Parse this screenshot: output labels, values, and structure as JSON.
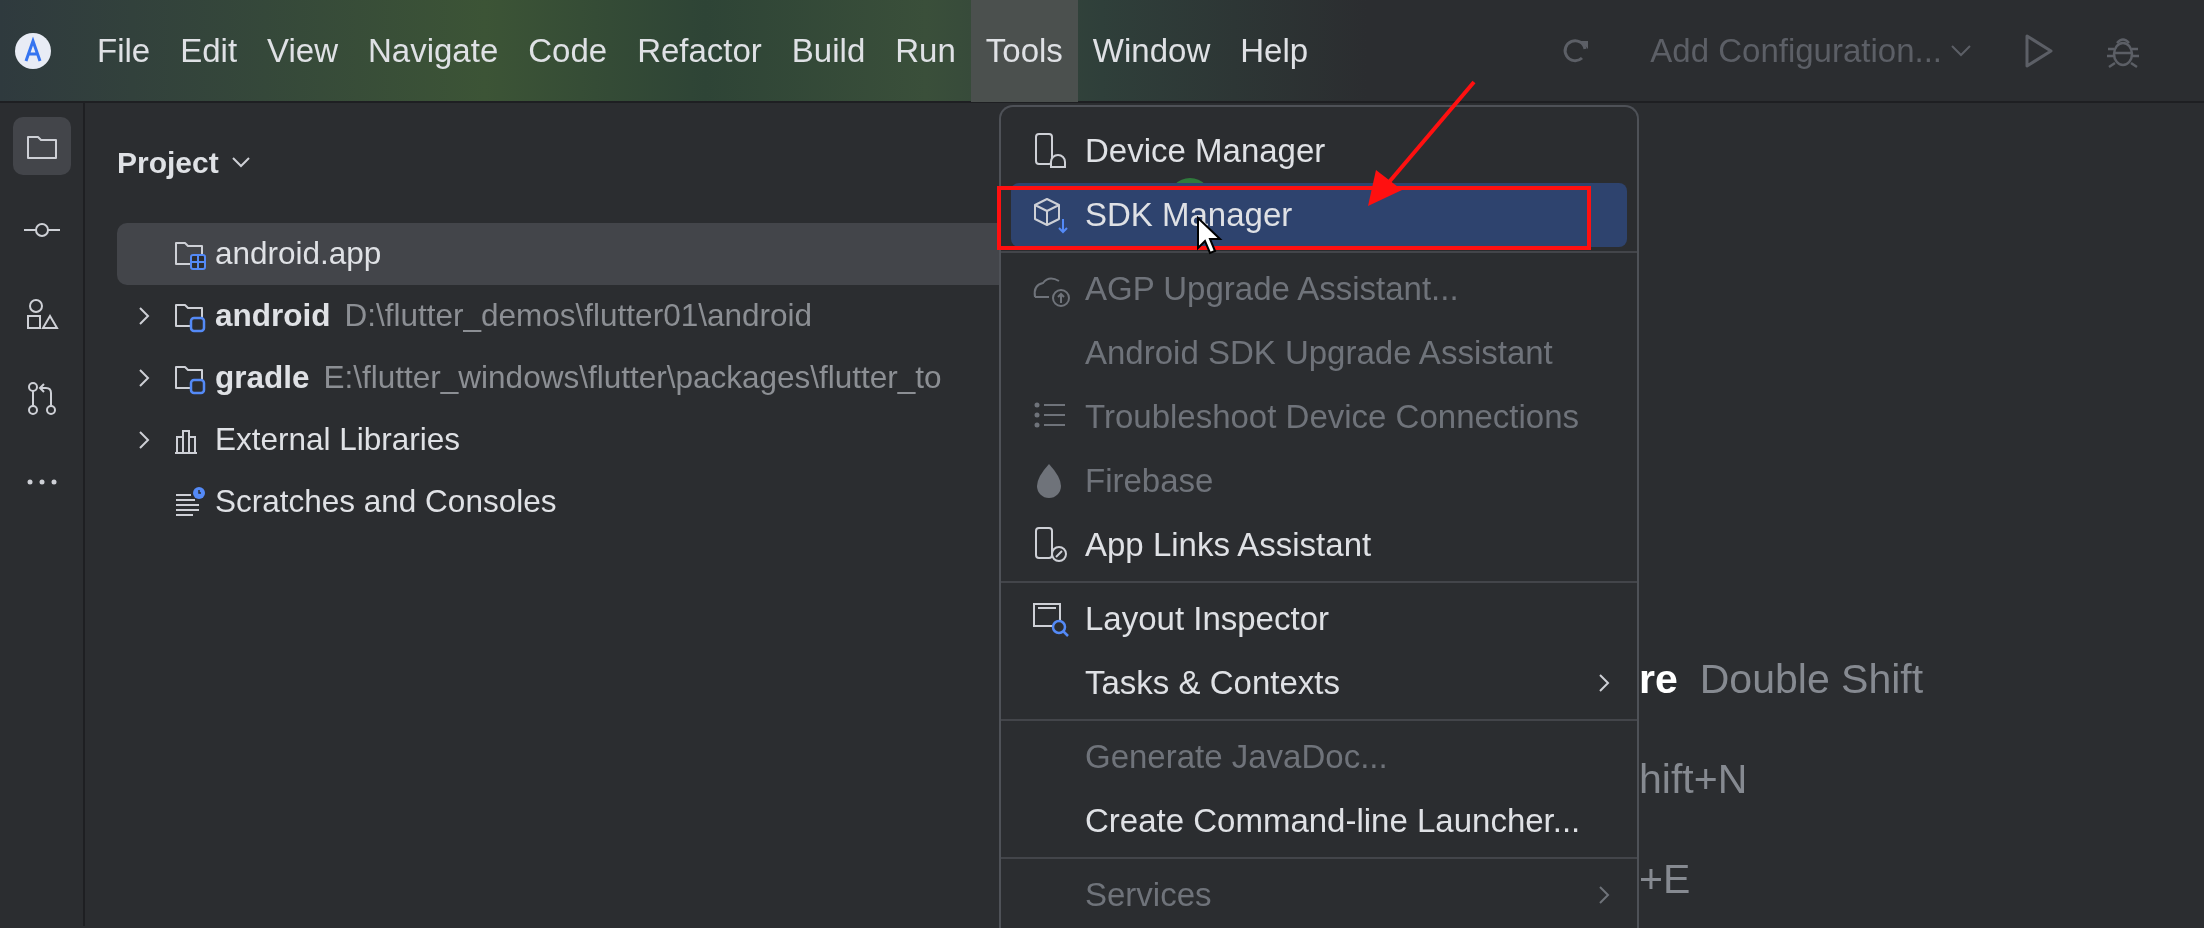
{
  "menu_bar": {
    "items": [
      {
        "label": "File",
        "selected": false
      },
      {
        "label": "Edit",
        "selected": false
      },
      {
        "label": "View",
        "selected": false
      },
      {
        "label": "Navigate",
        "selected": false
      },
      {
        "label": "Code",
        "selected": false
      },
      {
        "label": "Refactor",
        "selected": false
      },
      {
        "label": "Build",
        "selected": false
      },
      {
        "label": "Run",
        "selected": false
      },
      {
        "label": "Tools",
        "selected": true
      },
      {
        "label": "Window",
        "selected": false
      },
      {
        "label": "Help",
        "selected": false
      }
    ]
  },
  "toolbar": {
    "run_configuration": {
      "label": "Add Configuration...",
      "disabled": true
    }
  },
  "tool_windows": [
    {
      "selected": true
    },
    {
      "selected": false
    },
    {
      "selected": false
    },
    {
      "selected": false
    },
    {
      "selected": false
    }
  ],
  "project_panel": {
    "title": "Project",
    "items": [
      {
        "label": "android.app",
        "bold": false,
        "selected": true
      },
      {
        "label": "android",
        "bold": true,
        "path": "D:\\flutter_demos\\flutter01\\android",
        "expanded": false,
        "selected": false
      },
      {
        "label": "gradle",
        "bold": true,
        "path": "E:\\flutter_windows\\flutter\\packages\\flutter_to",
        "expanded": false,
        "selected": false
      },
      {
        "label": "External Libraries",
        "bold": false,
        "expanded": false,
        "selected": false
      },
      {
        "label": "Scratches and Consoles",
        "bold": false,
        "selected": false
      }
    ]
  },
  "editor_hints": [
    {
      "action": "re",
      "shortcut": "Double Shift"
    },
    {
      "shortcut": "hift+N"
    },
    {
      "shortcut": "+E"
    }
  ],
  "tools_menu": {
    "items": [
      {
        "kind": "item",
        "label": "Device Manager",
        "disabled": false,
        "selected": false
      },
      {
        "kind": "item",
        "label": "SDK Manager",
        "disabled": false,
        "selected": true
      },
      {
        "kind": "separator"
      },
      {
        "kind": "item",
        "label": "AGP Upgrade Assistant...",
        "disabled": true,
        "selected": false
      },
      {
        "kind": "item",
        "label": "Android SDK Upgrade Assistant",
        "disabled": true,
        "selected": false
      },
      {
        "kind": "item",
        "label": "Troubleshoot Device Connections",
        "disabled": true,
        "selected": false
      },
      {
        "kind": "item",
        "label": "Firebase",
        "disabled": true,
        "selected": false
      },
      {
        "kind": "item",
        "label": "App Links Assistant",
        "disabled": false,
        "selected": false
      },
      {
        "kind": "separator"
      },
      {
        "kind": "item",
        "label": "Layout Inspector",
        "disabled": false,
        "selected": false
      },
      {
        "kind": "item",
        "label": "Tasks & Contexts",
        "disabled": false,
        "selected": false,
        "submenu": true
      },
      {
        "kind": "separator"
      },
      {
        "kind": "item",
        "label": "Generate JavaDoc...",
        "disabled": true,
        "selected": false
      },
      {
        "kind": "item",
        "label": "Create Command-line Launcher...",
        "disabled": false,
        "selected": false
      },
      {
        "kind": "separator"
      },
      {
        "kind": "item",
        "label": "Services",
        "disabled": true,
        "selected": false,
        "submenu": true
      }
    ]
  }
}
